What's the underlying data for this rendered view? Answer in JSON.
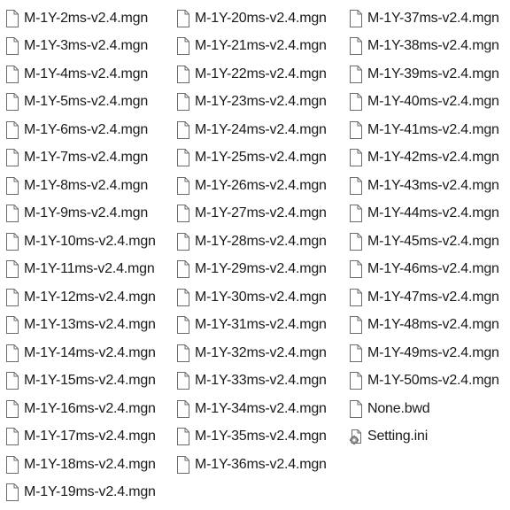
{
  "columns": [
    {
      "files": [
        {
          "name": "M-1Y-2ms-v2.4.mgn",
          "icon": "document-icon"
        },
        {
          "name": "M-1Y-3ms-v2.4.mgn",
          "icon": "document-icon"
        },
        {
          "name": "M-1Y-4ms-v2.4.mgn",
          "icon": "document-icon"
        },
        {
          "name": "M-1Y-5ms-v2.4.mgn",
          "icon": "document-icon"
        },
        {
          "name": "M-1Y-6ms-v2.4.mgn",
          "icon": "document-icon"
        },
        {
          "name": "M-1Y-7ms-v2.4.mgn",
          "icon": "document-icon"
        },
        {
          "name": "M-1Y-8ms-v2.4.mgn",
          "icon": "document-icon"
        },
        {
          "name": "M-1Y-9ms-v2.4.mgn",
          "icon": "document-icon"
        },
        {
          "name": "M-1Y-10ms-v2.4.mgn",
          "icon": "document-icon"
        },
        {
          "name": "M-1Y-11ms-v2.4.mgn",
          "icon": "document-icon"
        },
        {
          "name": "M-1Y-12ms-v2.4.mgn",
          "icon": "document-icon"
        },
        {
          "name": "M-1Y-13ms-v2.4.mgn",
          "icon": "document-icon"
        },
        {
          "name": "M-1Y-14ms-v2.4.mgn",
          "icon": "document-icon"
        },
        {
          "name": "M-1Y-15ms-v2.4.mgn",
          "icon": "document-icon"
        },
        {
          "name": "M-1Y-16ms-v2.4.mgn",
          "icon": "document-icon"
        },
        {
          "name": "M-1Y-17ms-v2.4.mgn",
          "icon": "document-icon"
        },
        {
          "name": "M-1Y-18ms-v2.4.mgn",
          "icon": "document-icon"
        },
        {
          "name": "M-1Y-19ms-v2.4.mgn",
          "icon": "document-icon"
        }
      ]
    },
    {
      "files": [
        {
          "name": "M-1Y-20ms-v2.4.mgn",
          "icon": "document-icon"
        },
        {
          "name": "M-1Y-21ms-v2.4.mgn",
          "icon": "document-icon"
        },
        {
          "name": "M-1Y-22ms-v2.4.mgn",
          "icon": "document-icon"
        },
        {
          "name": "M-1Y-23ms-v2.4.mgn",
          "icon": "document-icon"
        },
        {
          "name": "M-1Y-24ms-v2.4.mgn",
          "icon": "document-icon"
        },
        {
          "name": "M-1Y-25ms-v2.4.mgn",
          "icon": "document-icon"
        },
        {
          "name": "M-1Y-26ms-v2.4.mgn",
          "icon": "document-icon"
        },
        {
          "name": "M-1Y-27ms-v2.4.mgn",
          "icon": "document-icon"
        },
        {
          "name": "M-1Y-28ms-v2.4.mgn",
          "icon": "document-icon"
        },
        {
          "name": "M-1Y-29ms-v2.4.mgn",
          "icon": "document-icon"
        },
        {
          "name": "M-1Y-30ms-v2.4.mgn",
          "icon": "document-icon"
        },
        {
          "name": "M-1Y-31ms-v2.4.mgn",
          "icon": "document-icon"
        },
        {
          "name": "M-1Y-32ms-v2.4.mgn",
          "icon": "document-icon"
        },
        {
          "name": "M-1Y-33ms-v2.4.mgn",
          "icon": "document-icon"
        },
        {
          "name": "M-1Y-34ms-v2.4.mgn",
          "icon": "document-icon"
        },
        {
          "name": "M-1Y-35ms-v2.4.mgn",
          "icon": "document-icon"
        },
        {
          "name": "M-1Y-36ms-v2.4.mgn",
          "icon": "document-icon"
        }
      ]
    },
    {
      "files": [
        {
          "name": "M-1Y-37ms-v2.4.mgn",
          "icon": "document-icon"
        },
        {
          "name": "M-1Y-38ms-v2.4.mgn",
          "icon": "document-icon"
        },
        {
          "name": "M-1Y-39ms-v2.4.mgn",
          "icon": "document-icon"
        },
        {
          "name": "M-1Y-40ms-v2.4.mgn",
          "icon": "document-icon"
        },
        {
          "name": "M-1Y-41ms-v2.4.mgn",
          "icon": "document-icon"
        },
        {
          "name": "M-1Y-42ms-v2.4.mgn",
          "icon": "document-icon"
        },
        {
          "name": "M-1Y-43ms-v2.4.mgn",
          "icon": "document-icon"
        },
        {
          "name": "M-1Y-44ms-v2.4.mgn",
          "icon": "document-icon"
        },
        {
          "name": "M-1Y-45ms-v2.4.mgn",
          "icon": "document-icon"
        },
        {
          "name": "M-1Y-46ms-v2.4.mgn",
          "icon": "document-icon"
        },
        {
          "name": "M-1Y-47ms-v2.4.mgn",
          "icon": "document-icon"
        },
        {
          "name": "M-1Y-48ms-v2.4.mgn",
          "icon": "document-icon"
        },
        {
          "name": "M-1Y-49ms-v2.4.mgn",
          "icon": "document-icon"
        },
        {
          "name": "M-1Y-50ms-v2.4.mgn",
          "icon": "document-icon"
        },
        {
          "name": "None.bwd",
          "icon": "document-icon"
        },
        {
          "name": "Setting.ini",
          "icon": "settings-file-icon"
        }
      ]
    }
  ],
  "colors": {
    "text": "#1a1a1a",
    "icon_outline": "#6b6b6b",
    "icon_fill": "#ffffff",
    "gear": "#8a8a8a",
    "background": "#ffffff"
  }
}
